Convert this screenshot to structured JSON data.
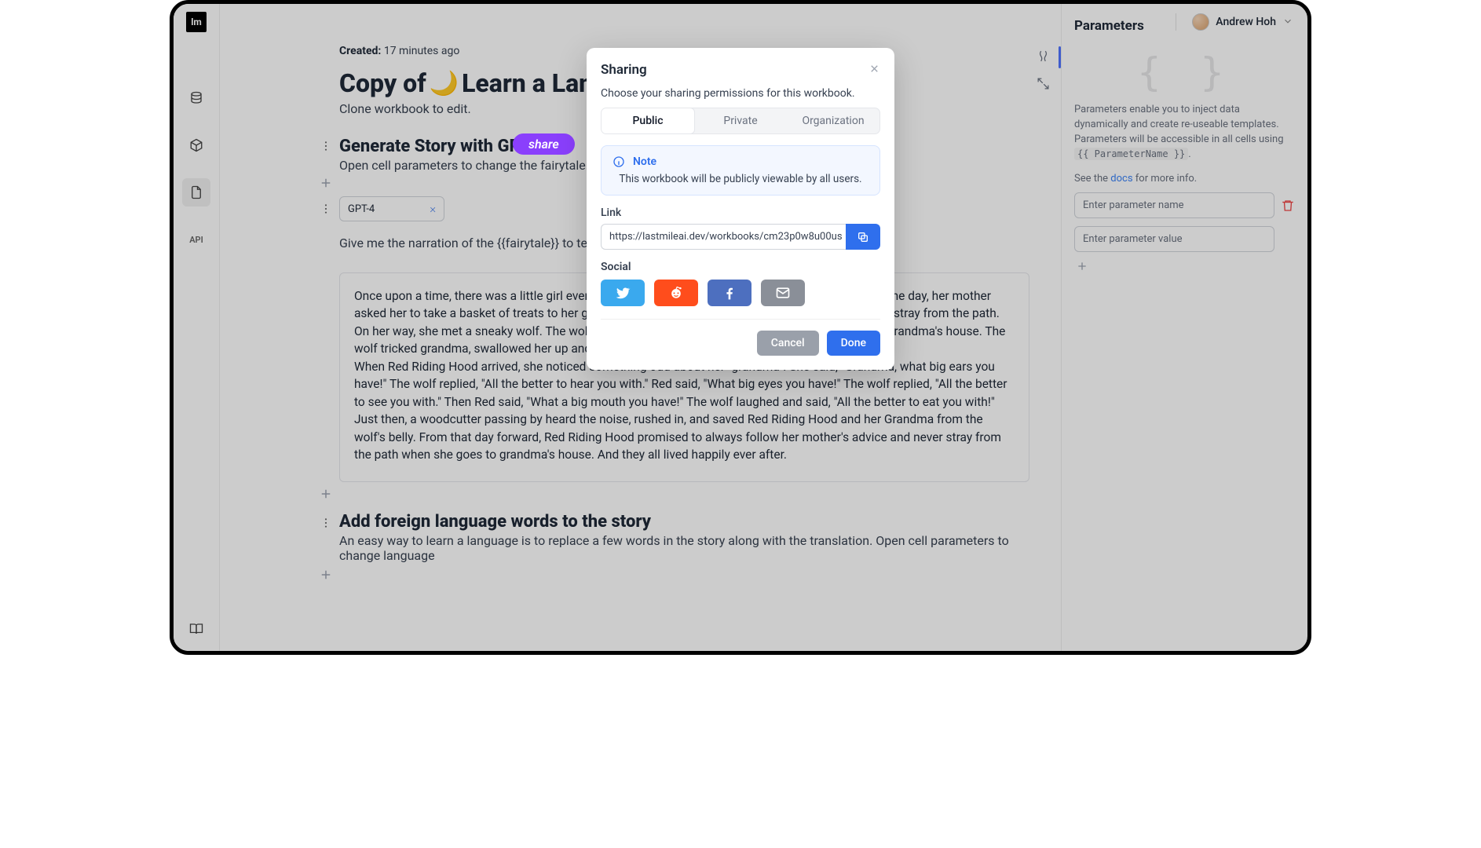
{
  "user": {
    "name": "Andrew Hoh"
  },
  "sidebar": {
    "api_label": "API"
  },
  "meta": {
    "created_label": "Created:",
    "created_value": "17 minutes ago"
  },
  "workbook": {
    "title_prefix": "Copy of ",
    "title_suffix": "Learn a Lang",
    "subtitle": "Clone workbook to edit."
  },
  "share_callout": "share",
  "section1": {
    "heading": "Generate Story with GPT4",
    "sub": "Open cell parameters to change the fairytale.",
    "model": "GPT-4",
    "prompt": "Give me the narration of the {{fairytale}} to tell a",
    "output_p1": "Once upon a time, there was a little girl everyone called Red Riding Hood because of her red hood. One day, her mother asked her to take a basket of treats to her grandma who lived in the woods. Her mom told her not to stray from the path.",
    "output_p2": "On her way, she met a sneaky wolf. The wolf discovered where she was going and rushed ahead to grandma's house. The wolf tricked grandma, swallowed her up and disguised himself as her.",
    "output_p3": "When Red Riding Hood arrived, she noticed something odd about her \"grandma\". She said, \"Grandma, what big ears you have!\" The wolf replied, \"All the better to hear you with.\" Red said, \"What big eyes you have!\" The wolf replied, \"All the better to see you with.\" Then Red said, \"What a big mouth you have!\" The wolf laughed and said, \"All the better to eat you with!\"",
    "output_p4": "Just then, a woodcutter passing by heard the noise, rushed in, and saved Red Riding Hood and her Grandma from the wolf's belly. From that day forward, Red Riding Hood promised to always follow her mother's advice and never stray from the path when she goes to grandma's house. And they all lived happily ever after."
  },
  "section2": {
    "heading": "Add foreign language words to the story",
    "sub": "An easy way to learn a language is to replace a few words in the story along with the translation. Open cell parameters to change language"
  },
  "params_panel": {
    "title": "Parameters",
    "desc_a": "Parameters enable you to inject data dynamically and create re-useable templates. Parameters will be accessible in all cells using ",
    "desc_code": "{{ ParameterName }}",
    "desc_b": ".",
    "docs_a": "See the ",
    "docs_link": "docs",
    "docs_b": " for more info.",
    "name_placeholder": "Enter parameter name",
    "value_placeholder": "Enter parameter value"
  },
  "modal": {
    "title": "Sharing",
    "desc": "Choose your sharing permissions for this workbook.",
    "tabs": {
      "public": "Public",
      "private": "Private",
      "org": "Organization"
    },
    "note_title": "Note",
    "note_body": "This workbook will be publicly viewable by all users.",
    "link_label": "Link",
    "link_value": "https://lastmileai.dev/workbooks/cm23p0w8u00us",
    "social_label": "Social",
    "cancel": "Cancel",
    "done": "Done"
  }
}
